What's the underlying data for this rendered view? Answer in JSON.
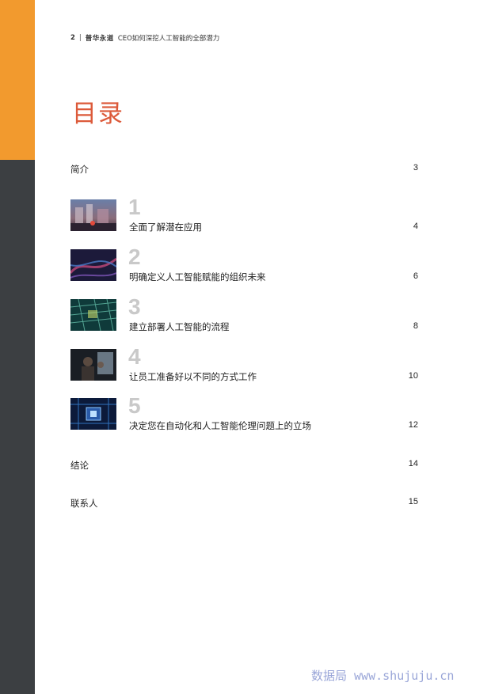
{
  "header": {
    "page_number": "2",
    "separator": "|",
    "brand": "普华永道",
    "doc_title": "CEO如何深挖人工智能的全部潜力"
  },
  "title": "目录",
  "intro": {
    "label": "简介",
    "page": "3"
  },
  "chapters": [
    {
      "number": "1",
      "label": "全面了解潜在应用",
      "page": "4"
    },
    {
      "number": "2",
      "label": "明确定义人工智能赋能的组织未来",
      "page": "6"
    },
    {
      "number": "3",
      "label": "建立部署人工智能的流程",
      "page": "8"
    },
    {
      "number": "4",
      "label": "让员工准备好以不同的方式工作",
      "page": "10"
    },
    {
      "number": "5",
      "label": "决定您在自动化和人工智能伦理问题上的立场",
      "page": "12"
    }
  ],
  "conclusion": {
    "label": "结论",
    "page": "14"
  },
  "contacts": {
    "label": "联系人",
    "page": "15"
  },
  "watermark": "数据局 www.shujuju.cn",
  "colors": {
    "accent": "#dc5a3a",
    "orange_bar": "#f29a2e",
    "gray_bar": "#3c3f42",
    "chapter_number": "#c9c9c9"
  }
}
